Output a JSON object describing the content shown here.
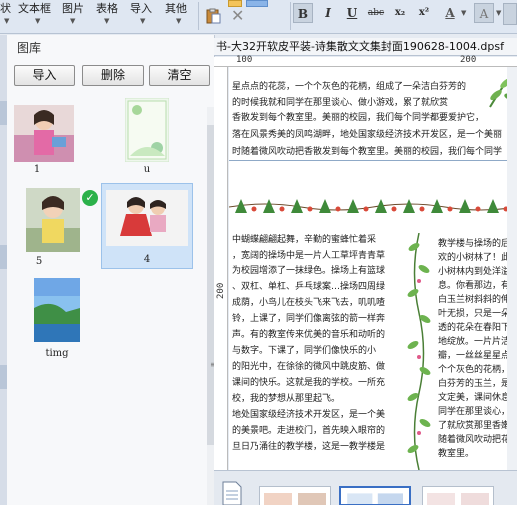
{
  "toolbar": {
    "menu": [
      {
        "label": "状",
        "x_hint": "first"
      },
      {
        "label": "文本框"
      },
      {
        "label": "图片"
      },
      {
        "label": "表格"
      },
      {
        "label": "导入"
      },
      {
        "label": "其他"
      }
    ],
    "format_buttons": [
      "B",
      "I",
      "U",
      "abc",
      "x₂",
      "x²",
      "A",
      "A"
    ]
  },
  "gallery": {
    "title": "图库",
    "buttons": {
      "import": "导入",
      "delete": "删除",
      "clear": "清空"
    },
    "images": [
      {
        "caption": "1",
        "selected": false,
        "checked": false,
        "icon": "photo-girl-pink-dress"
      },
      {
        "caption": "u",
        "selected": false,
        "checked": false,
        "icon": "photo-green-stationery"
      },
      {
        "caption": "5",
        "selected": false,
        "checked": true,
        "icon": "photo-girl-yellow-shirt"
      },
      {
        "caption": "4",
        "selected": true,
        "checked": false,
        "icon": "photo-two-children-seated"
      },
      {
        "caption": "timg",
        "selected": false,
        "checked": false,
        "icon": "photo-seascape"
      }
    ]
  },
  "document": {
    "tab_title": "书-大32开软皮平装-诗集散文文集封面190628-1004.dpsf",
    "ruler_top": [
      "100",
      "200"
    ],
    "ruler_left": [
      "200"
    ],
    "top_lines": [
      "星点点的花蕊，一个个灰色的花柄，组成了一朵洁白芬芳的",
      "的时候我就和同学在那里谈心、做小游戏，累了就欣赏",
      "香散发到每个教室里。美丽的校园，我们每个同学都要爱护它，",
      "落在风景秀美的凤鸣湖畔，地处国家级经济技术开发区，是一个美丽",
      "时随着微风吹动把香散发到每个教室里。美丽的校园，我们每个同学"
    ],
    "left_column": [
      "中蝴蝶翩翩起舞，辛勤的蜜蜂忙着采",
      "，宽阔的操场中是一片人工草坪青青草",
      "为校园增添了一抹绿色。操场上有篮球",
      "、双杠、单杠、乒乓球案…操场四周绿",
      "成荫，小鸟儿在枝头飞来飞去，叽叽喳",
      "铃，上课了，同学们像离弦的箭一样奔",
      "声。有的教室传来优美的音乐和动听的",
      "与数字。下课了，同学们像快乐的小",
      "的阳光中，在徐徐的微风中跳皮筋、做",
      "课间的快乐。这就是我的学校。一所充",
      "校，我的梦想从那里起飞。",
      "地处国家级经济技术开发区，是一个美",
      "的美景吧。走进校门，首先映入眼帘的",
      "旦日乃涌往的教学楼，这是一教学楼是"
    ],
    "right_column": [
      "教学楼与操场的后",
      "欢的小树林了！此",
      "小树林内到处洋溢",
      "息。你看那边，有",
      "白玉兰树斜斜的伸",
      "叶无损，只是一朵",
      "透的花朵在春阳下",
      "地绽放。一片片洁",
      "瓣，一丝丝星星点",
      "个个灰色的花柄，",
      "白芬芳的玉兰，是",
      "文定美，课间休息",
      "同学在那里谈心，",
      "了就欣赏那里香嫩",
      "随着微风吹动把花",
      "教室里。"
    ]
  },
  "colors": {
    "accent": "#3a6fc4",
    "selection": "#cfe3f8",
    "check_green": "#2bb14a"
  }
}
